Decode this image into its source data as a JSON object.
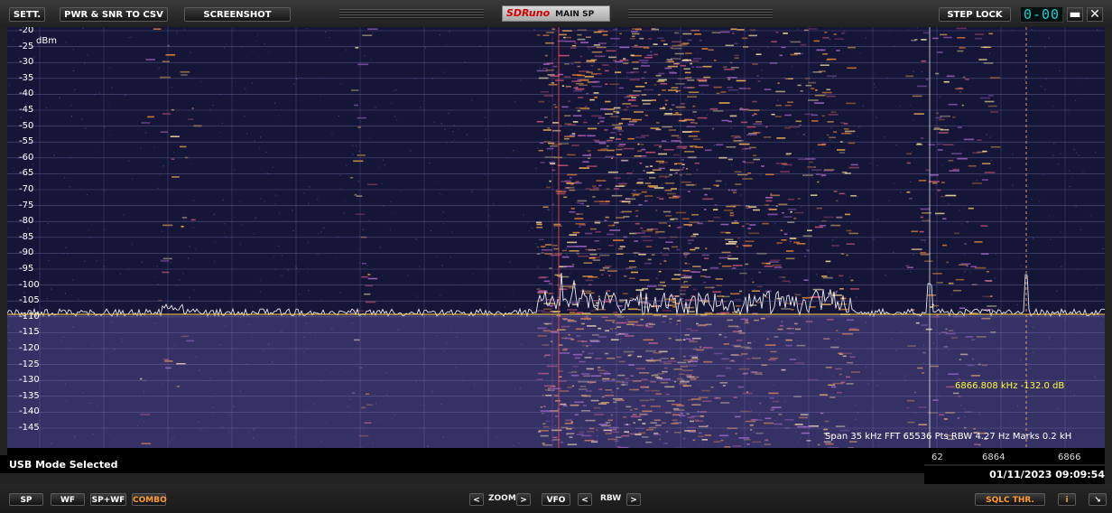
{
  "toolbar": {
    "settings_label": "SETT.",
    "csv_label": "PWR & SNR TO CSV",
    "screenshot_label": "SCREENSHOT",
    "brand": "SDRuno",
    "window_name": "MAIN SP",
    "step_lock_label": "STEP LOCK",
    "display_readout": "0-00",
    "minimize_glyph": "▬",
    "close_glyph": "✕"
  },
  "spectrum": {
    "unit_label": "dBm",
    "y_labels": [
      "-20",
      "-25",
      "-30",
      "-35",
      "-40",
      "-45",
      "-50",
      "-55",
      "-60",
      "-65",
      "-70",
      "-75",
      "-80",
      "-85",
      "-90",
      "-95",
      "-100",
      "-105",
      "-110",
      "-115",
      "-120",
      "-125",
      "-130",
      "-135",
      "-140",
      "-145"
    ],
    "cursor_readout": "6866.808 kHz -132.0 dB",
    "info_line": "Span 35 kHz   FFT 65536 Pts   RBW 4.27 Hz   Marks 0.2 kH",
    "freq_labels": [
      "62",
      "6864",
      "6866"
    ],
    "colors": {
      "background": "#151538",
      "trace": "#ffffff",
      "grid": "#6a6a9a",
      "marker": "#ff5050"
    }
  },
  "status": {
    "mode_text": "USB Mode Selected",
    "datetime": "01/11/2023 09:09:54"
  },
  "bottombar": {
    "sp_label": "SP",
    "wf_label": "WF",
    "spwf_label": "SP+WF",
    "combo_label": "COMBO",
    "zoom_label": "ZOOM",
    "vfo_label": "VFO",
    "rbw_label": "RBW",
    "prev_glyph": "<",
    "next_glyph": ">",
    "sqlc_label": "SQLC THR.",
    "info_label": "i",
    "resize_glyph": "↘"
  }
}
